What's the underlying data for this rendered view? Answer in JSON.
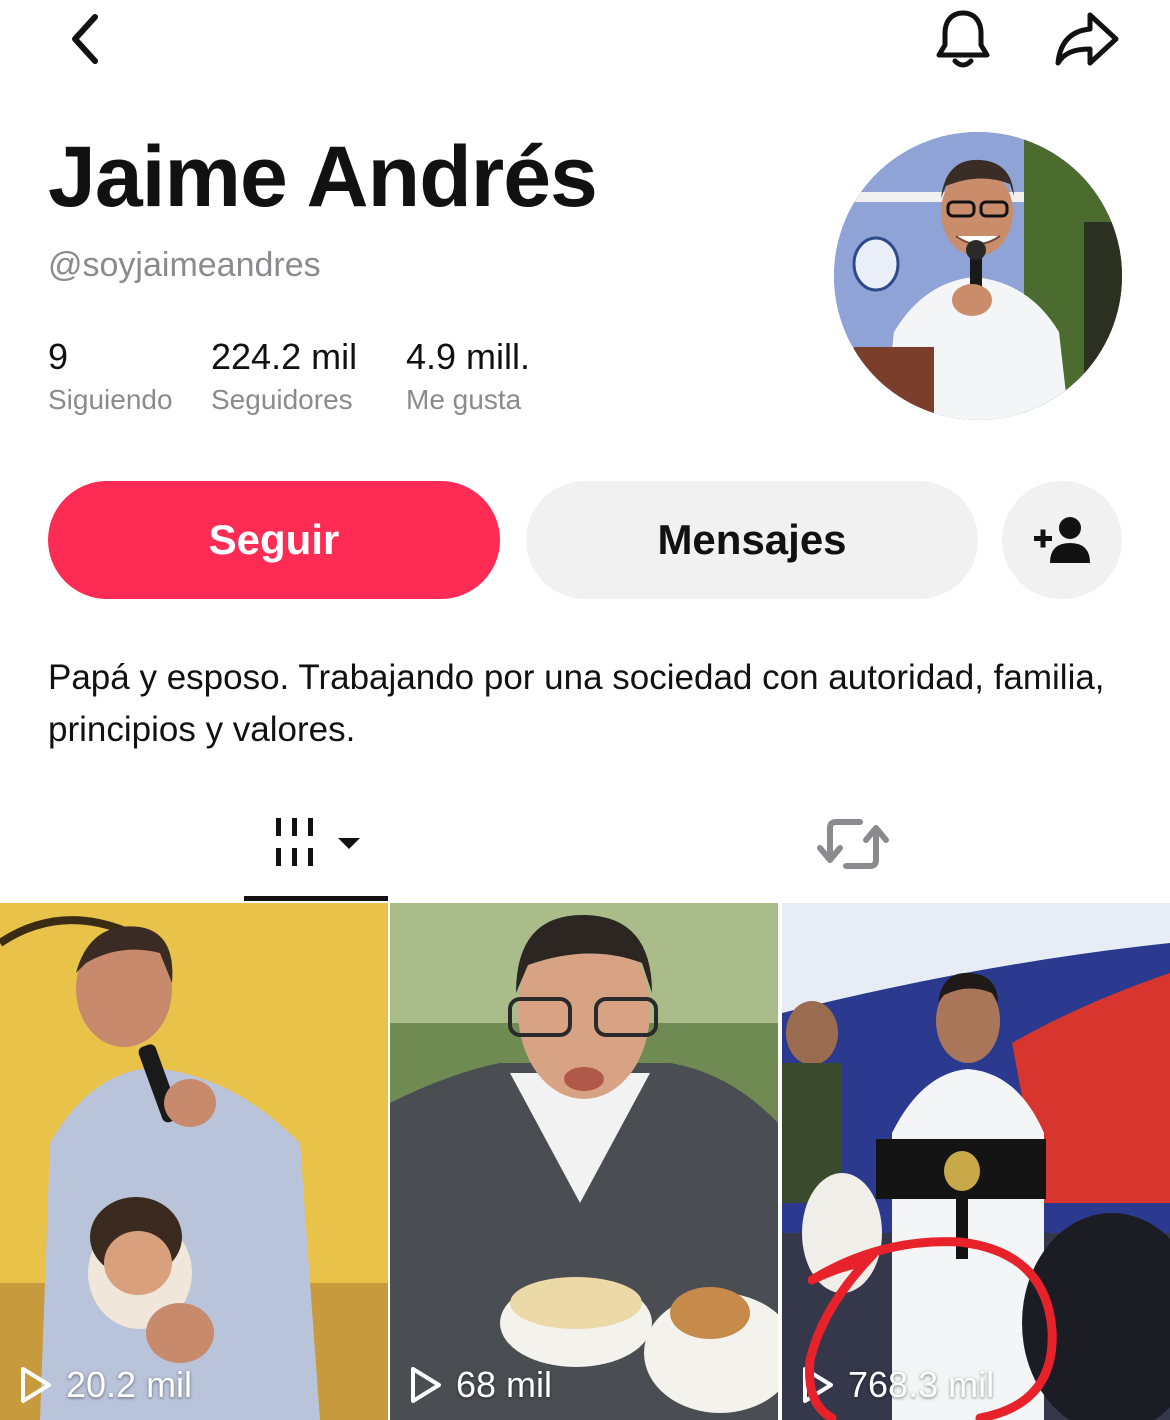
{
  "header": {
    "back_icon": "chevron-left-icon",
    "bell_icon": "bell-icon",
    "share_icon": "share-arrow-icon"
  },
  "profile": {
    "name": "Jaime Andrés",
    "handle": "@soyjaimeandres",
    "bio": "Papá y esposo. Trabajando por una sociedad con autoridad, familia, principios y valores."
  },
  "stats": [
    {
      "value": "9",
      "label": "Siguiendo"
    },
    {
      "value": "224.2 mil",
      "label": "Seguidores"
    },
    {
      "value": "4.9 mill.",
      "label": "Me gusta"
    }
  ],
  "actions": {
    "follow": "Seguir",
    "messages": "Mensajes",
    "add_friend_icon": "add-person-icon"
  },
  "tabs": {
    "videos_icon": "video-grid-icon",
    "reposts_icon": "repost-icon"
  },
  "videos": [
    {
      "views": "20.2 mil"
    },
    {
      "views": "68 mil"
    },
    {
      "views": "768.3 mil"
    }
  ],
  "colors": {
    "accent": "#fe2c55",
    "annotation": "#e8222a"
  }
}
